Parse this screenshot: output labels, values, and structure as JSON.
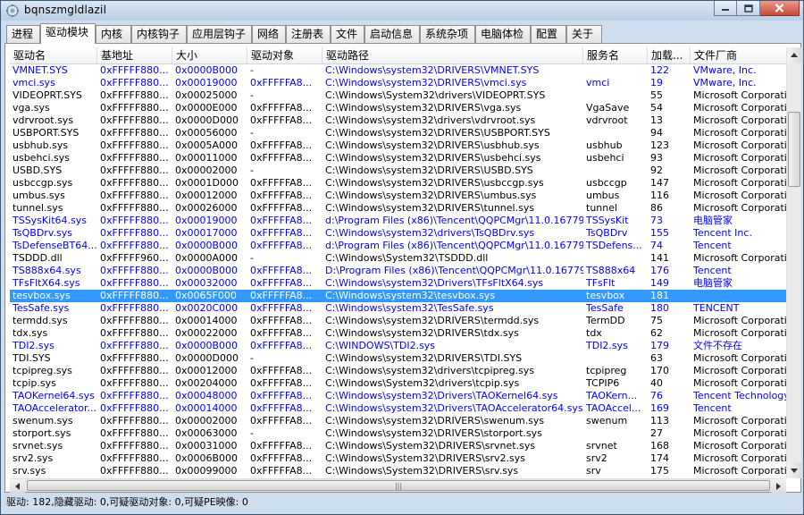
{
  "window": {
    "title": "bqnszmgldlazil",
    "icon": "gear-app-icon",
    "controls": [
      "minimize-icon",
      "maximize-icon",
      "close-icon"
    ]
  },
  "tabs": [
    {
      "label": "进程",
      "active": false
    },
    {
      "label": "驱动模块",
      "active": true
    },
    {
      "label": "内核",
      "active": false
    },
    {
      "label": "内核钩子",
      "active": false
    },
    {
      "label": "应用层钩子",
      "active": false
    },
    {
      "label": "网络",
      "active": false
    },
    {
      "label": "注册表",
      "active": false
    },
    {
      "label": "文件",
      "active": false
    },
    {
      "label": "启动信息",
      "active": false
    },
    {
      "label": "系统杂项",
      "active": false
    },
    {
      "label": "电脑体检",
      "active": false
    },
    {
      "label": "配置",
      "active": false
    },
    {
      "label": "关于",
      "active": false
    }
  ],
  "columns": [
    "驱动名",
    "基地址",
    "大小",
    "驱动对象",
    "驱动路径",
    "服务名",
    "加载...",
    "文件厂商"
  ],
  "rows": [
    {
      "name": "VMNET.SYS",
      "base": "0xFFFFF880...",
      "size": "0x0000B000",
      "obj": "-",
      "path": "C:\\Windows\\system32\\DRIVERS\\VMNET.SYS",
      "service": "",
      "load": "122",
      "vendor": "VMware, Inc.",
      "type": "tp"
    },
    {
      "name": "vmci.sys",
      "base": "0xFFFFF880...",
      "size": "0x00019000",
      "obj": "0xFFFFFA8...",
      "path": "C:\\Windows\\system32\\DRIVERS\\vmci.sys",
      "service": "vmci",
      "load": "19",
      "vendor": "VMware, Inc.",
      "type": "tp"
    },
    {
      "name": "VIDEOPRT.SYS",
      "base": "0xFFFFF880...",
      "size": "0x00025000",
      "obj": "-",
      "path": "C:\\Windows\\System32\\drivers\\VIDEOPRT.SYS",
      "service": "",
      "load": "55",
      "vendor": "Microsoft Corporation",
      "type": "ms"
    },
    {
      "name": "vga.sys",
      "base": "0xFFFFF880...",
      "size": "0x0000E000",
      "obj": "0xFFFFFA8...",
      "path": "C:\\Windows\\system32\\DRIVERS\\vga.sys",
      "service": "VgaSave",
      "load": "54",
      "vendor": "Microsoft Corporation",
      "type": "ms"
    },
    {
      "name": "vdrvroot.sys",
      "base": "0xFFFFF880...",
      "size": "0x0000D000",
      "obj": "0xFFFFFA8...",
      "path": "C:\\Windows\\system32\\drivers\\vdrvroot.sys",
      "service": "vdrvroot",
      "load": "13",
      "vendor": "Microsoft Corporation",
      "type": "ms"
    },
    {
      "name": "USBPORT.SYS",
      "base": "0xFFFFF880...",
      "size": "0x00056000",
      "obj": "-",
      "path": "C:\\Windows\\system32\\DRIVERS\\USBPORT.SYS",
      "service": "",
      "load": "94",
      "vendor": "Microsoft Corporation",
      "type": "ms"
    },
    {
      "name": "usbhub.sys",
      "base": "0xFFFFF880...",
      "size": "0x0005A000",
      "obj": "0xFFFFFA8...",
      "path": "C:\\Windows\\system32\\DRIVERS\\usbhub.sys",
      "service": "usbhub",
      "load": "123",
      "vendor": "Microsoft Corporation",
      "type": "ms"
    },
    {
      "name": "usbehci.sys",
      "base": "0xFFFFF880...",
      "size": "0x00011000",
      "obj": "0xFFFFFA8...",
      "path": "C:\\Windows\\system32\\DRIVERS\\usbehci.sys",
      "service": "usbehci",
      "load": "93",
      "vendor": "Microsoft Corporation",
      "type": "ms"
    },
    {
      "name": "USBD.SYS",
      "base": "0xFFFFF880...",
      "size": "0x00002000",
      "obj": "-",
      "path": "C:\\Windows\\system32\\DRIVERS\\USBD.SYS",
      "service": "",
      "load": "92",
      "vendor": "Microsoft Corporation",
      "type": "ms"
    },
    {
      "name": "usbccgp.sys",
      "base": "0xFFFFF880...",
      "size": "0x0001D000",
      "obj": "0xFFFFFA8...",
      "path": "C:\\Windows\\system32\\DRIVERS\\usbccgp.sys",
      "service": "usbccgp",
      "load": "147",
      "vendor": "Microsoft Corporation",
      "type": "ms"
    },
    {
      "name": "umbus.sys",
      "base": "0xFFFFF880...",
      "size": "0x00012000",
      "obj": "0xFFFFFA8...",
      "path": "C:\\Windows\\system32\\DRIVERS\\umbus.sys",
      "service": "umbus",
      "load": "116",
      "vendor": "Microsoft Corporation",
      "type": "ms"
    },
    {
      "name": "tunnel.sys",
      "base": "0xFFFFF880...",
      "size": "0x00026000",
      "obj": "0xFFFFFA8...",
      "path": "C:\\Windows\\system32\\DRIVERS\\tunnel.sys",
      "service": "tunnel",
      "load": "86",
      "vendor": "Microsoft Corporation",
      "type": "ms"
    },
    {
      "name": "TSSysKit64.sys",
      "base": "0xFFFFF880...",
      "size": "0x00019000",
      "obj": "0xFFFFFA8...",
      "path": "d:\\Program Files (x86)\\Tencent\\QQPCMgr\\11.0.16779....",
      "service": "TSSysKit",
      "load": "73",
      "vendor": "电脑管家",
      "type": "tp"
    },
    {
      "name": "TsQBDrv.sys",
      "base": "0xFFFFF880...",
      "size": "0x00017000",
      "obj": "0xFFFFFA8...",
      "path": "C:\\Windows\\system32\\drivers\\TsQBDrv.sys",
      "service": "TsQBDrv",
      "load": "155",
      "vendor": "Tencent Inc.",
      "type": "tp"
    },
    {
      "name": "TsDefenseBT64...",
      "base": "0xFFFFF880...",
      "size": "0x0000B000",
      "obj": "0xFFFFFA8...",
      "path": "d:\\Program Files (x86)\\Tencent\\QQPCMgr\\11.0.16779....",
      "service": "TSDefens...",
      "load": "74",
      "vendor": "Tencent",
      "type": "tp"
    },
    {
      "name": "TSDDD.dll",
      "base": "0xFFFFF960...",
      "size": "0x0000A000",
      "obj": "-",
      "path": "C:\\Windows\\System32\\TSDDD.dll",
      "service": "",
      "load": "141",
      "vendor": "Microsoft Corporation",
      "type": "ms"
    },
    {
      "name": "TS888x64.sys",
      "base": "0xFFFFF880...",
      "size": "0x0000B000",
      "obj": "0xFFFFFA8...",
      "path": "D:\\Program Files (x86)\\Tencent\\QQPCMgr\\11.0.16779....",
      "service": "TS888x64",
      "load": "176",
      "vendor": "Tencent",
      "type": "tp"
    },
    {
      "name": "TFsFltX64.sys",
      "base": "0xFFFFF880...",
      "size": "0x00032000",
      "obj": "0xFFFFFA8...",
      "path": "C:\\Windows\\system32\\Drivers\\TFsFltX64.sys",
      "service": "TFsFlt",
      "load": "149",
      "vendor": "电脑管家",
      "type": "tp"
    },
    {
      "name": "tesvbox.sys",
      "base": "0xFFFFF880...",
      "size": "0x0065F000",
      "obj": "0xFFFFFA8...",
      "path": "C:\\Windows\\system32\\tesvbox.sys",
      "service": "tesvbox",
      "load": "181",
      "vendor": "",
      "type": "sel"
    },
    {
      "name": "TesSafe.sys",
      "base": "0xFFFFF880...",
      "size": "0x0020C000",
      "obj": "0xFFFFFA8...",
      "path": "C:\\Windows\\system32\\TesSafe.sys",
      "service": "TesSafe",
      "load": "180",
      "vendor": "TENCENT",
      "type": "tp"
    },
    {
      "name": "termdd.sys",
      "base": "0xFFFFF880...",
      "size": "0x00014000",
      "obj": "0xFFFFFA8...",
      "path": "C:\\Windows\\system32\\DRIVERS\\termdd.sys",
      "service": "TermDD",
      "load": "75",
      "vendor": "Microsoft Corporation",
      "type": "ms"
    },
    {
      "name": "tdx.sys",
      "base": "0xFFFFF880...",
      "size": "0x00022000",
      "obj": "0xFFFFFA8...",
      "path": "C:\\Windows\\system32\\DRIVERS\\tdx.sys",
      "service": "tdx",
      "load": "62",
      "vendor": "Microsoft Corporation",
      "type": "ms"
    },
    {
      "name": "TDI2.sys",
      "base": "0xFFFFF880...",
      "size": "0x0000B000",
      "obj": "0xFFFFFA8...",
      "path": "C:\\WINDOWS\\TDI2.sys",
      "service": "TDI2.sys",
      "load": "179",
      "vendor": "文件不存在",
      "type": "tp"
    },
    {
      "name": "TDI.SYS",
      "base": "0xFFFFF880...",
      "size": "0x0000D000",
      "obj": "-",
      "path": "C:\\Windows\\system32\\DRIVERS\\TDI.SYS",
      "service": "",
      "load": "63",
      "vendor": "Microsoft Corporation",
      "type": "ms"
    },
    {
      "name": "tcpipreg.sys",
      "base": "0xFFFFF880...",
      "size": "0x00012000",
      "obj": "0xFFFFFA8...",
      "path": "C:\\Windows\\system32\\drivers\\tcpipreg.sys",
      "service": "tcpipreg",
      "load": "170",
      "vendor": "Microsoft Corporation",
      "type": "ms"
    },
    {
      "name": "tcpip.sys",
      "base": "0xFFFFF880...",
      "size": "0x00204000",
      "obj": "0xFFFFFA8...",
      "path": "C:\\Windows\\System32\\drivers\\tcpip.sys",
      "service": "TCPIP6",
      "load": "40",
      "vendor": "Microsoft Corporation",
      "type": "ms"
    },
    {
      "name": "TAOKernel64.sys",
      "base": "0xFFFFF880...",
      "size": "0x00048000",
      "obj": "0xFFFFFA8...",
      "path": "C:\\Windows\\system32\\Drivers\\TAOKernel64.sys",
      "service": "TAOKern...",
      "load": "76",
      "vendor": "Tencent Technology...",
      "type": "tp"
    },
    {
      "name": "TAOAccelerator...",
      "base": "0xFFFFF880...",
      "size": "0x00014000",
      "obj": "0xFFFFFA8...",
      "path": "C:\\Windows\\system32\\Drivers\\TAOAccelerator64.sys",
      "service": "TAOAccel...",
      "load": "169",
      "vendor": "Tencent",
      "type": "tp"
    },
    {
      "name": "swenum.sys",
      "base": "0xFFFFF880...",
      "size": "0x00002000",
      "obj": "0xFFFFFA8...",
      "path": "C:\\Windows\\system32\\DRIVERS\\swenum.sys",
      "service": "swenum",
      "load": "113",
      "vendor": "Microsoft Corporation",
      "type": "ms"
    },
    {
      "name": "storport.sys",
      "base": "0xFFFFF880...",
      "size": "0x00063000",
      "obj": "-",
      "path": "C:\\Windows\\system32\\DRIVERS\\storport.sys",
      "service": "",
      "load": "27",
      "vendor": "Microsoft Corporation",
      "type": "ms"
    },
    {
      "name": "srvnet.sys",
      "base": "0xFFFFF880...",
      "size": "0x00031000",
      "obj": "0xFFFFFA8...",
      "path": "C:\\Windows\\System32\\DRIVERS\\srvnet.sys",
      "service": "srvnet",
      "load": "168",
      "vendor": "Microsoft Corporation",
      "type": "ms"
    },
    {
      "name": "srv2.sys",
      "base": "0xFFFFF880...",
      "size": "0x0006B000",
      "obj": "0xFFFFFA8...",
      "path": "C:\\Windows\\System32\\DRIVERS\\srv2.sys",
      "service": "srv2",
      "load": "174",
      "vendor": "Microsoft Corporation",
      "type": "ms"
    },
    {
      "name": "srv.sys",
      "base": "0xFFFFF880...",
      "size": "0x00099000",
      "obj": "0xFFFFFA8...",
      "path": "C:\\Windows\\System32\\DRIVERS\\srv.sys",
      "service": "srv",
      "load": "175",
      "vendor": "Microsoft Corporation",
      "type": "ms"
    }
  ],
  "status": "驱动: 182,隐藏驱动: 0,可疑驱动对象: 0,可疑PE映像: 0",
  "scrollbars": {
    "vertical": [
      "scroll-up-icon",
      "scroll-down-icon"
    ],
    "horizontal": [
      "scroll-left-icon",
      "scroll-right-icon"
    ],
    "grip": "|||"
  }
}
